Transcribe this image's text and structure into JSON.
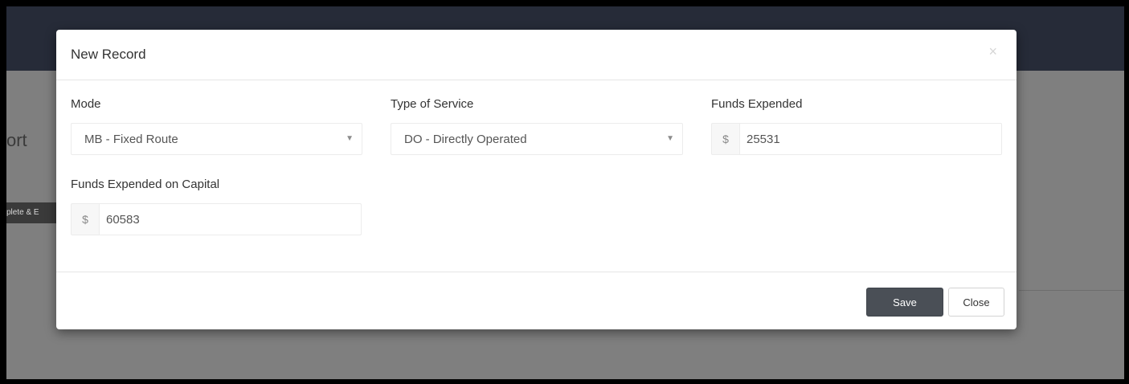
{
  "background": {
    "page_title_fragment": "ort",
    "button_fragment": "plete & E"
  },
  "modal": {
    "title": "New Record",
    "close_icon": "close-icon",
    "fields": {
      "mode": {
        "label": "Mode",
        "value": "MB - Fixed Route"
      },
      "type_of_service": {
        "label": "Type of Service",
        "value": "DO - Directly Operated"
      },
      "funds_expended": {
        "label": "Funds Expended",
        "currency": "$",
        "value": "25531"
      },
      "funds_expended_capital": {
        "label": "Funds Expended on Capital",
        "currency": "$",
        "value": "60583"
      }
    },
    "footer": {
      "save_label": "Save",
      "close_label": "Close"
    }
  },
  "colors": {
    "header_bg": "#262b38",
    "overlay_bg": "#7f7f7f",
    "save_button": "#4a4f56"
  }
}
